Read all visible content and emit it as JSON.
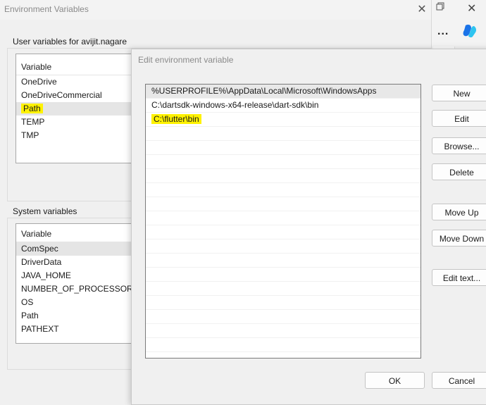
{
  "env_window": {
    "title": "Environment Variables",
    "user_group_label": "User variables for avijit.nagare",
    "system_group_label": "System variables",
    "user_list": {
      "header": "Variable",
      "rows": [
        "OneDrive",
        "OneDriveCommercial",
        "Path",
        "TEMP",
        "TMP"
      ],
      "selected_index": 2
    },
    "system_list": {
      "header": "Variable",
      "rows": [
        "ComSpec",
        "DriverData",
        "JAVA_HOME",
        "NUMBER_OF_PROCESSORS",
        "OS",
        "Path",
        "PATHEXT"
      ],
      "selected_index": 0
    }
  },
  "edit_dialog": {
    "title": "Edit environment variable",
    "entries": [
      "%USERPROFILE%\\AppData\\Local\\Microsoft\\WindowsApps",
      "C:\\dartsdk-windows-x64-release\\dart-sdk\\bin",
      "C:\\flutter\\bin"
    ],
    "highlighted_index": 2,
    "buttons": {
      "new": "New",
      "edit": "Edit",
      "browse": "Browse...",
      "delete": "Delete",
      "move_up": "Move Up",
      "move_down": "Move Down",
      "edit_text": "Edit text...",
      "ok": "OK",
      "cancel": "Cancel"
    }
  },
  "background_app": {
    "more_label": "...",
    "icons": [
      "restore-icon",
      "close-icon",
      "copilot-icon"
    ]
  },
  "colors": {
    "highlight": "#fff200",
    "copilot_blue": "#1a73e8"
  }
}
